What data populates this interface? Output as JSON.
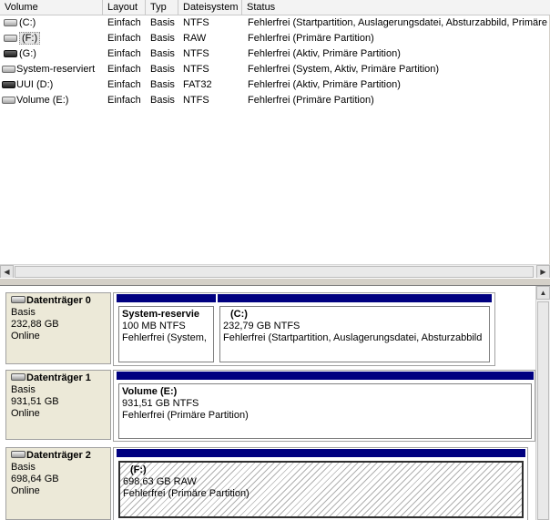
{
  "columns": [
    "Volume",
    "Layout",
    "Typ",
    "Dateisystem",
    "Status"
  ],
  "volumes": [
    {
      "name": "(C:)",
      "layout": "Einfach",
      "type": "Basis",
      "fs": "NTFS",
      "status": "Fehlerfrei (Startpartition, Auslagerungsdatei, Absturzabbild, Primäre P",
      "icon": "drive-icon"
    },
    {
      "name": "(F:)",
      "layout": "Einfach",
      "type": "Basis",
      "fs": "RAW",
      "status": "Fehlerfrei (Primäre Partition)",
      "icon": "drive-icon"
    },
    {
      "name": "(G:)",
      "layout": "Einfach",
      "type": "Basis",
      "fs": "NTFS",
      "status": "Fehlerfrei (Aktiv, Primäre Partition)",
      "icon": "removable-drive-icon"
    },
    {
      "name": "System-reserviert",
      "layout": "Einfach",
      "type": "Basis",
      "fs": "NTFS",
      "status": "Fehlerfrei (System, Aktiv, Primäre Partition)",
      "icon": "drive-icon"
    },
    {
      "name": "UUI (D:)",
      "layout": "Einfach",
      "type": "Basis",
      "fs": "FAT32",
      "status": "Fehlerfrei (Aktiv, Primäre Partition)",
      "icon": "removable-drive-icon"
    },
    {
      "name": "Volume (E:)",
      "layout": "Einfach",
      "type": "Basis",
      "fs": "NTFS",
      "status": "Fehlerfrei (Primäre Partition)",
      "icon": "drive-icon"
    }
  ],
  "disks": [
    {
      "name": "Datenträger 0",
      "type": "Basis",
      "size": "232,88 GB",
      "state": "Online",
      "partitions": [
        {
          "name": "System-reservie",
          "size": "100 MB NTFS",
          "status": "Fehlerfrei (System,"
        },
        {
          "name": "(C:)",
          "size": "232,79 GB NTFS",
          "status": "Fehlerfrei (Startpartition, Auslagerungsdatei, Absturzabbild"
        }
      ]
    },
    {
      "name": "Datenträger 1",
      "type": "Basis",
      "size": "931,51 GB",
      "state": "Online",
      "partitions": [
        {
          "name": "Volume  (E:)",
          "size": "931,51 GB NTFS",
          "status": "Fehlerfrei (Primäre Partition)"
        }
      ]
    },
    {
      "name": "Datenträger 2",
      "type": "Basis",
      "size": "698,64 GB",
      "state": "Online",
      "partitions": [
        {
          "name": "(F:)",
          "size": "698,63 GB RAW",
          "status": "Fehlerfrei (Primäre Partition)"
        }
      ]
    }
  ],
  "colors": {
    "partition_bar": "#000080",
    "info_panel": "#ece9d8"
  }
}
